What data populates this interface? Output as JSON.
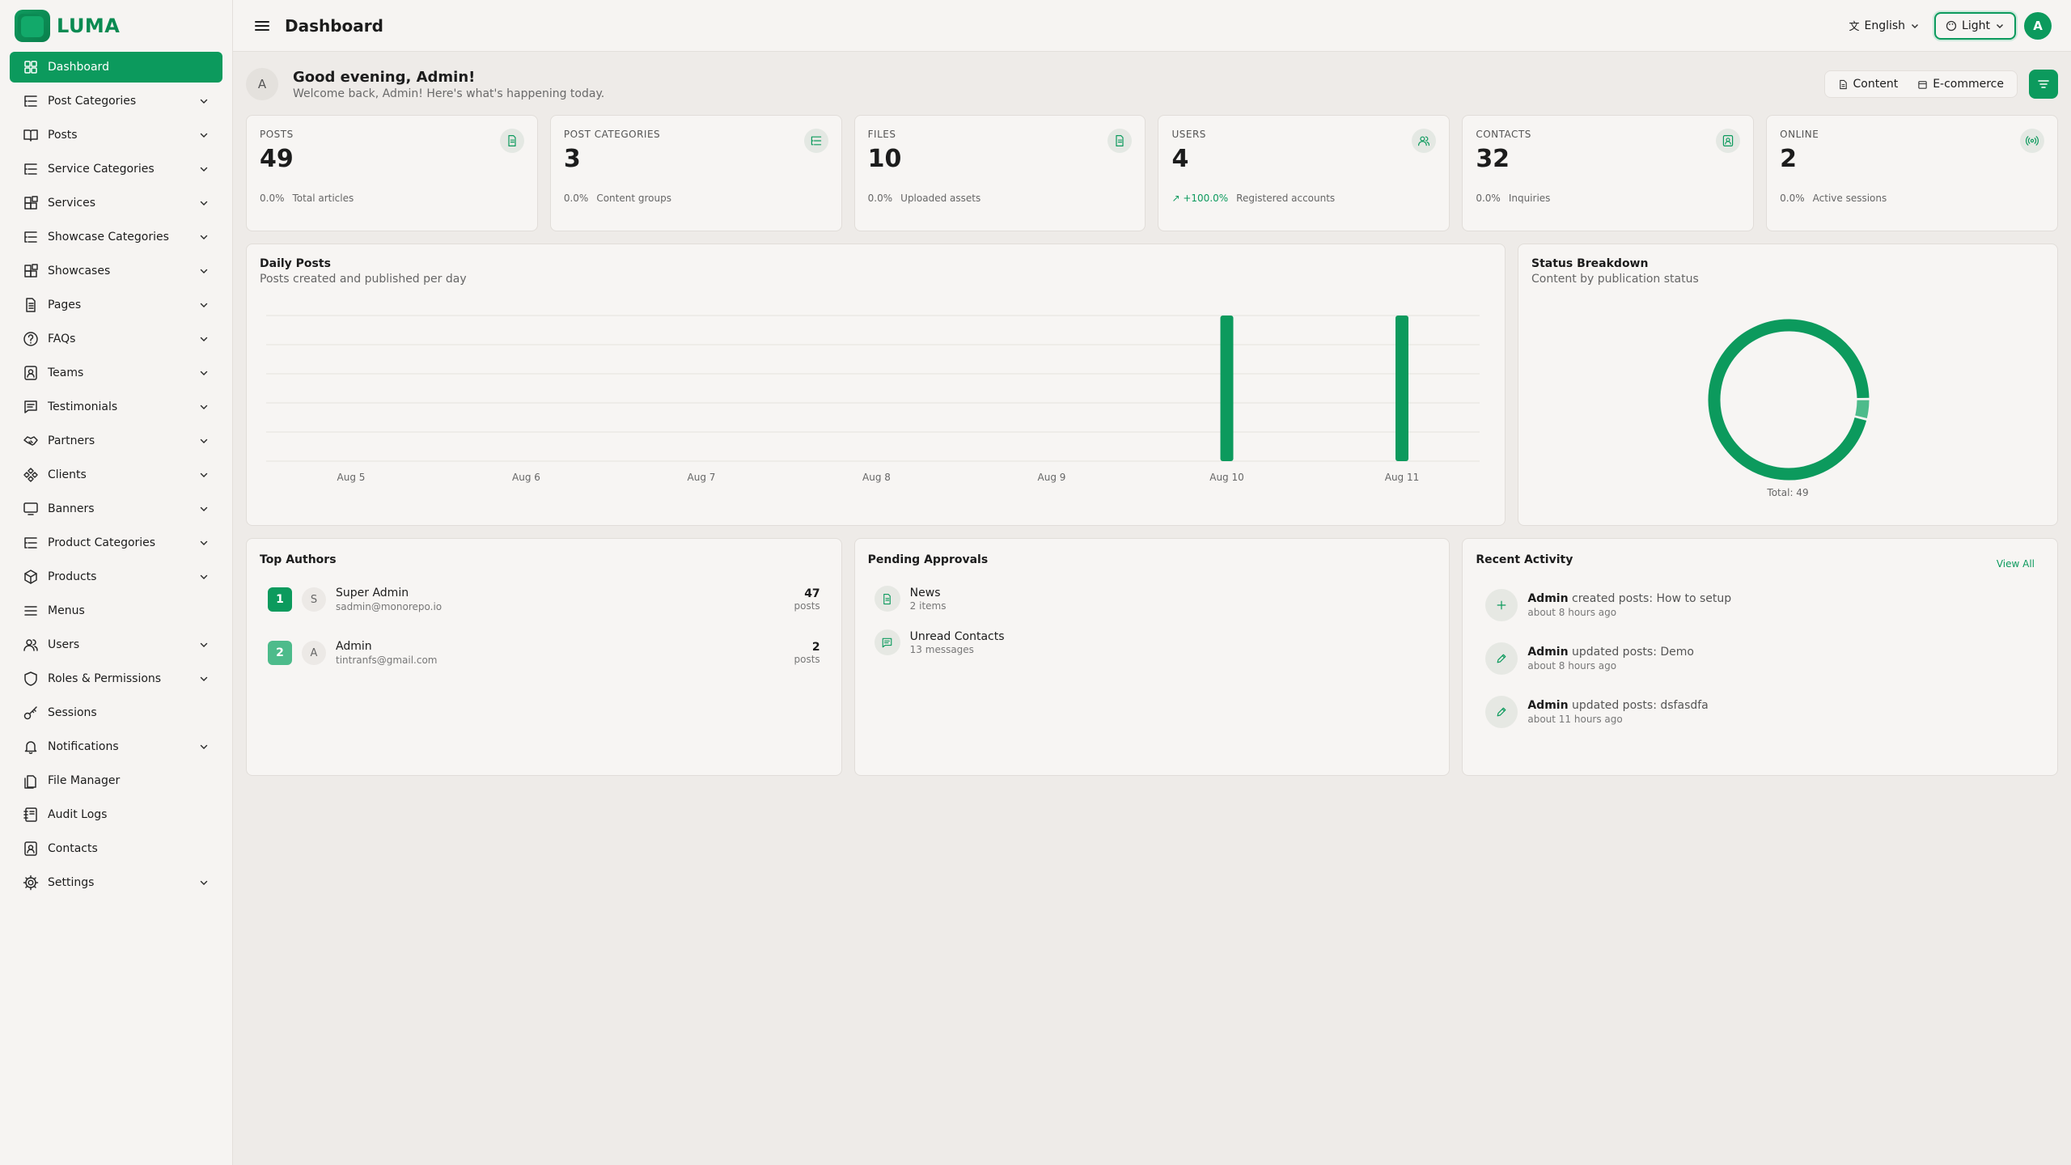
{
  "brand": {
    "name": "LUMA"
  },
  "sidebar": {
    "items": [
      {
        "label": "Dashboard",
        "icon": "grid-icon",
        "active": true,
        "chevron": false
      },
      {
        "label": "Post Categories",
        "icon": "list-tree-icon",
        "chevron": true
      },
      {
        "label": "Posts",
        "icon": "book-open-icon",
        "chevron": true
      },
      {
        "label": "Service Categories",
        "icon": "list-tree-icon",
        "chevron": true
      },
      {
        "label": "Services",
        "icon": "blocks-icon",
        "chevron": true
      },
      {
        "label": "Showcase Categories",
        "icon": "list-tree-icon",
        "chevron": true
      },
      {
        "label": "Showcases",
        "icon": "blocks-icon",
        "chevron": true
      },
      {
        "label": "Pages",
        "icon": "file-text-icon",
        "chevron": true
      },
      {
        "label": "FAQs",
        "icon": "help-circle-icon",
        "chevron": true
      },
      {
        "label": "Teams",
        "icon": "contact-square-icon",
        "chevron": true
      },
      {
        "label": "Testimonials",
        "icon": "message-square-icon",
        "chevron": true
      },
      {
        "label": "Partners",
        "icon": "handshake-icon",
        "chevron": true
      },
      {
        "label": "Clients",
        "icon": "diamond-nodes-icon",
        "chevron": true
      },
      {
        "label": "Banners",
        "icon": "monitor-icon",
        "chevron": true
      },
      {
        "label": "Product Categories",
        "icon": "list-tree-icon",
        "chevron": true
      },
      {
        "label": "Products",
        "icon": "package-icon",
        "chevron": true
      },
      {
        "label": "Menus",
        "icon": "menu-icon",
        "chevron": false
      },
      {
        "label": "Users",
        "icon": "users-icon",
        "chevron": true
      },
      {
        "label": "Roles & Permissions",
        "icon": "shield-icon",
        "chevron": true
      },
      {
        "label": "Sessions",
        "icon": "key-icon",
        "chevron": false
      },
      {
        "label": "Notifications",
        "icon": "bell-icon",
        "chevron": true
      },
      {
        "label": "File Manager",
        "icon": "files-icon",
        "chevron": false
      },
      {
        "label": "Audit Logs",
        "icon": "notebook-icon",
        "chevron": false
      },
      {
        "label": "Contacts",
        "icon": "contact-square-icon",
        "chevron": false
      },
      {
        "label": "Settings",
        "icon": "gear-icon",
        "chevron": true
      }
    ]
  },
  "header": {
    "title": "Dashboard",
    "language": "English",
    "theme": "Light",
    "avatar_initial": "A"
  },
  "greeting": {
    "avatar_initial": "A",
    "title": "Good evening, Admin!",
    "subtitle": "Welcome back, Admin! Here's what's happening today.",
    "tabs": [
      "Content",
      "E-commerce"
    ]
  },
  "stats": [
    {
      "label": "POSTS",
      "value": "49",
      "change": "0.0%",
      "desc": "Total articles",
      "trend_up": false,
      "icon": "file-icon"
    },
    {
      "label": "POST CATEGORIES",
      "value": "3",
      "change": "0.0%",
      "desc": "Content groups",
      "trend_up": false,
      "icon": "list-tree-icon"
    },
    {
      "label": "FILES",
      "value": "10",
      "change": "0.0%",
      "desc": "Uploaded assets",
      "trend_up": false,
      "icon": "file-icon"
    },
    {
      "label": "USERS",
      "value": "4",
      "change": "+100.0%",
      "desc": "Registered accounts",
      "trend_up": true,
      "icon": "users-icon"
    },
    {
      "label": "CONTACTS",
      "value": "32",
      "change": "0.0%",
      "desc": "Inquiries",
      "trend_up": false,
      "icon": "contact-square-icon"
    },
    {
      "label": "ONLINE",
      "value": "2",
      "change": "0.0%",
      "desc": "Active sessions",
      "trend_up": false,
      "icon": "radio-icon"
    }
  ],
  "daily_posts": {
    "title": "Daily Posts",
    "subtitle": "Posts created and published per day"
  },
  "status_breakdown": {
    "title": "Status Breakdown",
    "subtitle": "Content by publication status",
    "total_label": "Total: 49"
  },
  "chart_data": [
    {
      "type": "bar",
      "title": "Daily Posts",
      "categories": [
        "Aug 5",
        "Aug 6",
        "Aug 7",
        "Aug 8",
        "Aug 9",
        "Aug 10",
        "Aug 11"
      ],
      "values": [
        0,
        0,
        0,
        0,
        0,
        1,
        1
      ],
      "grid": true
    },
    {
      "type": "pie",
      "title": "Status Breakdown",
      "values": [
        47,
        2
      ],
      "colors": [
        "#0c9a5d",
        "#4dbb8b"
      ],
      "total": 49
    }
  ],
  "top_authors": {
    "title": "Top Authors",
    "items": [
      {
        "rank": "1",
        "initial": "S",
        "name": "Super Admin",
        "email": "sadmin@monorepo.io",
        "count": "47",
        "unit": "posts",
        "color": "#0c9a5d"
      },
      {
        "rank": "2",
        "initial": "A",
        "name": "Admin",
        "email": "tintranfs@gmail.com",
        "count": "2",
        "unit": "posts",
        "color": "#4dbb8b"
      }
    ]
  },
  "pending": {
    "title": "Pending Approvals",
    "items": [
      {
        "title": "News",
        "sub": "2 items",
        "icon": "file-icon"
      },
      {
        "title": "Unread Contacts",
        "sub": "13 messages",
        "icon": "message-square-icon"
      }
    ]
  },
  "activity": {
    "title": "Recent Activity",
    "view_all": "View All",
    "items": [
      {
        "actor": "Admin",
        "action": "created posts: How to setup",
        "time": "about 8 hours ago",
        "icon": "plus-icon"
      },
      {
        "actor": "Admin",
        "action": "updated posts: Demo",
        "time": "about 8 hours ago",
        "icon": "pencil-icon"
      },
      {
        "actor": "Admin",
        "action": "updated posts: dsfasdfa",
        "time": "about 11 hours ago",
        "icon": "pencil-icon"
      }
    ]
  },
  "colors": {
    "accent": "#0c9a5d",
    "accent_light": "#4dbb8b",
    "bg": "#eeebe8",
    "card": "#f7f5f3"
  }
}
